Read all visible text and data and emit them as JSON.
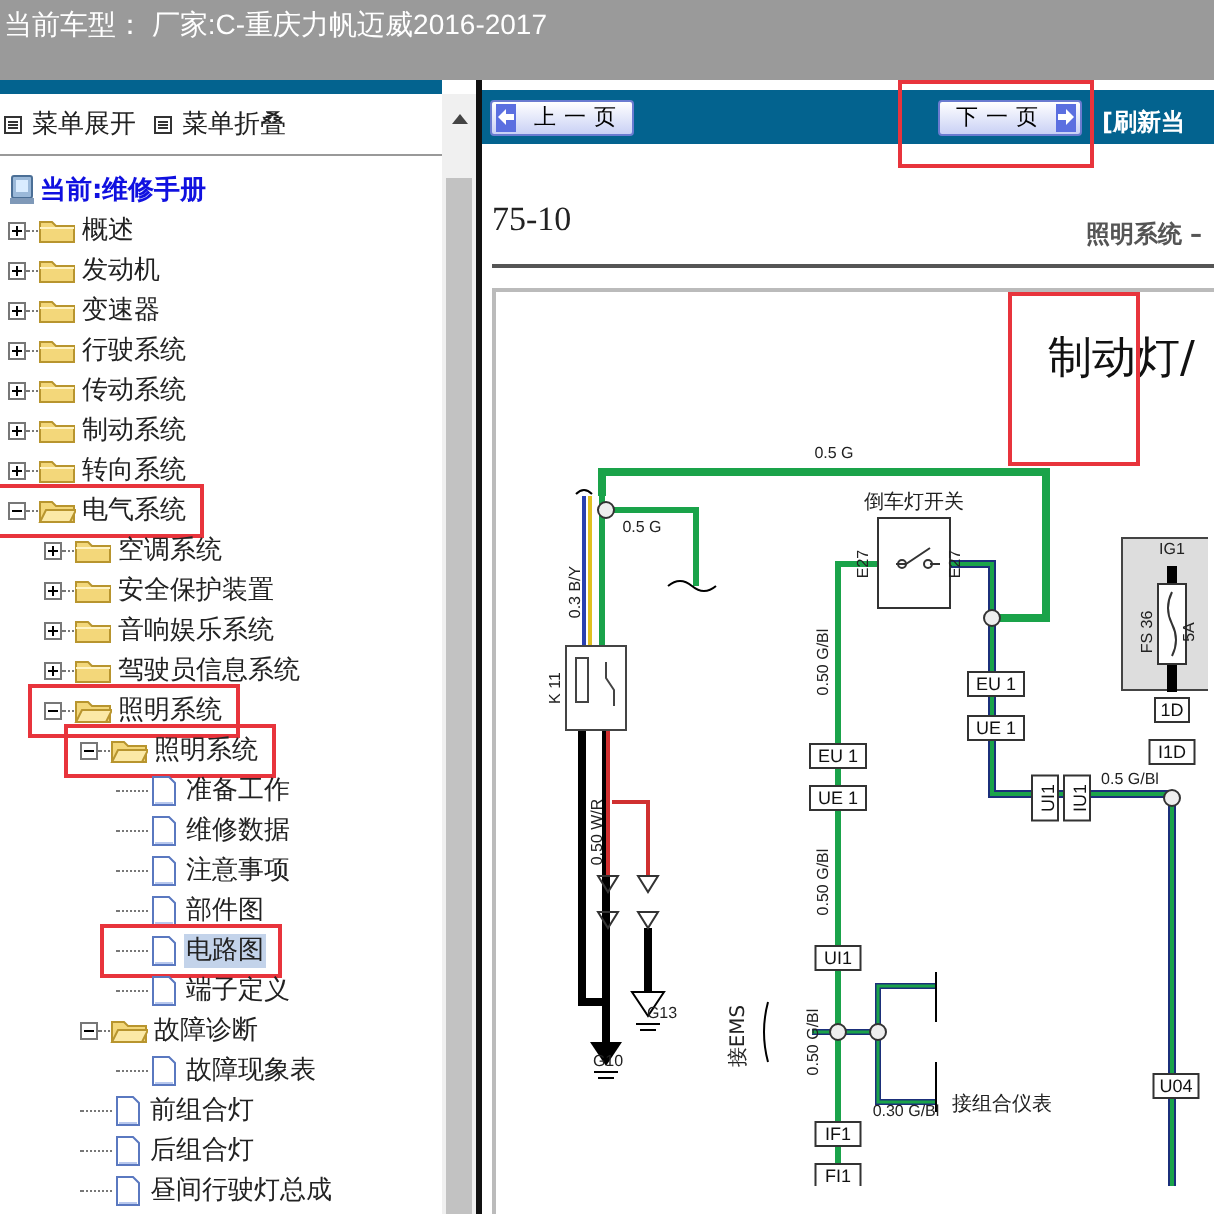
{
  "header": {
    "title": "当前车型： 厂家:C-重庆力帆迈威2016-2017"
  },
  "menu_controls": [
    {
      "label": "菜单展开"
    },
    {
      "label": "菜单折叠"
    }
  ],
  "tree": {
    "root": "当前:维修手册",
    "items": [
      {
        "label": "概述",
        "kind": "folder",
        "expanded": false,
        "selected": false,
        "highlighted": false
      },
      {
        "label": "发动机",
        "kind": "folder",
        "expanded": false,
        "selected": false,
        "highlighted": false
      },
      {
        "label": "变速器",
        "kind": "folder",
        "expanded": false,
        "selected": false,
        "highlighted": false
      },
      {
        "label": "行驶系统",
        "kind": "folder",
        "expanded": false,
        "selected": false,
        "highlighted": false
      },
      {
        "label": "传动系统",
        "kind": "folder",
        "expanded": false,
        "selected": false,
        "highlighted": false
      },
      {
        "label": "制动系统",
        "kind": "folder",
        "expanded": false,
        "selected": false,
        "highlighted": false
      },
      {
        "label": "转向系统",
        "kind": "folder",
        "expanded": false,
        "selected": false,
        "highlighted": false
      },
      {
        "label": "电气系统",
        "kind": "folder",
        "expanded": true,
        "selected": false,
        "highlighted": true,
        "children": [
          {
            "label": "空调系统",
            "kind": "folder",
            "expanded": false,
            "selected": false,
            "highlighted": false
          },
          {
            "label": "安全保护装置",
            "kind": "folder",
            "expanded": false,
            "selected": false,
            "highlighted": false
          },
          {
            "label": "音响娱乐系统",
            "kind": "folder",
            "expanded": false,
            "selected": false,
            "highlighted": false
          },
          {
            "label": "驾驶员信息系统",
            "kind": "folder",
            "expanded": false,
            "selected": false,
            "highlighted": false
          },
          {
            "label": "照明系统",
            "kind": "folder",
            "expanded": true,
            "selected": false,
            "highlighted": true,
            "children": [
              {
                "label": "照明系统",
                "kind": "folder",
                "expanded": true,
                "selected": false,
                "highlighted": true,
                "children": [
                  {
                    "label": "准备工作",
                    "kind": "doc",
                    "selected": false,
                    "highlighted": false
                  },
                  {
                    "label": "维修数据",
                    "kind": "doc",
                    "selected": false,
                    "highlighted": false
                  },
                  {
                    "label": "注意事项",
                    "kind": "doc",
                    "selected": false,
                    "highlighted": false
                  },
                  {
                    "label": "部件图",
                    "kind": "doc",
                    "selected": false,
                    "highlighted": false
                  },
                  {
                    "label": "电路图",
                    "kind": "doc",
                    "selected": true,
                    "highlighted": true
                  },
                  {
                    "label": "端子定义",
                    "kind": "doc",
                    "selected": false,
                    "highlighted": false
                  }
                ]
              },
              {
                "label": "故障诊断",
                "kind": "folder",
                "expanded": true,
                "selected": false,
                "highlighted": false,
                "children": [
                  {
                    "label": "故障现象表",
                    "kind": "doc",
                    "selected": false,
                    "highlighted": false
                  }
                ]
              },
              {
                "label": "前组合灯",
                "kind": "doc",
                "selected": false,
                "highlighted": false
              },
              {
                "label": "后组合灯",
                "kind": "doc",
                "selected": false,
                "highlighted": false
              },
              {
                "label": "昼间行驶灯总成",
                "kind": "doc",
                "selected": false,
                "highlighted": false
              }
            ]
          }
        ]
      }
    ]
  },
  "toolbar": {
    "buttons": [
      {
        "label": "上一页",
        "kind": "prev",
        "highlighted": false
      },
      {
        "label": "下一页",
        "kind": "next",
        "highlighted": true
      }
    ],
    "refresh_link": "[刷新当"
  },
  "document": {
    "page_number": "75-10",
    "running_head": "照明系统 –",
    "diagram_title": "制动灯/",
    "title_highlighted": true,
    "labels": [
      {
        "text": "0.5 G",
        "kind": "wire"
      },
      {
        "text": "0.5 G",
        "kind": "wire"
      },
      {
        "text": "0.3 B/Y",
        "kind": "wire"
      },
      {
        "text": "K 11",
        "kind": "wire"
      },
      {
        "text": "0.50 W/R",
        "kind": "wire"
      },
      {
        "text": "G13",
        "kind": "wire"
      },
      {
        "text": "G10",
        "kind": "wire"
      },
      {
        "text": "0.50 G/Bl",
        "kind": "wire"
      },
      {
        "text": "EU 1",
        "kind": "connector"
      },
      {
        "text": "UE 1",
        "kind": "connector"
      },
      {
        "text": "0.50 G/Bl",
        "kind": "wire"
      },
      {
        "text": "UI1",
        "kind": "connector"
      },
      {
        "text": "0.50 G/Bl",
        "kind": "wire"
      },
      {
        "text": "IF1",
        "kind": "connector"
      },
      {
        "text": "FI1",
        "kind": "connector"
      },
      {
        "text": "0.30 G/Bl",
        "kind": "wire"
      },
      {
        "text": "EU 1",
        "kind": "connector"
      },
      {
        "text": "UE 1",
        "kind": "connector"
      },
      {
        "text": "0.5 G/Bl",
        "kind": "wire"
      },
      {
        "text": "IG1",
        "kind": "wire"
      },
      {
        "text": "FS 36",
        "kind": "wire"
      },
      {
        "text": "5A",
        "kind": "wire"
      },
      {
        "text": "1D",
        "kind": "connector"
      },
      {
        "text": "I1D",
        "kind": "connector"
      },
      {
        "text": "U04",
        "kind": "connector"
      },
      {
        "text": "E27",
        "kind": "wire"
      },
      {
        "text": "E27",
        "kind": "wire"
      },
      {
        "text": "接EMS",
        "kind": "note"
      },
      {
        "text": "接组合仪表",
        "kind": "note"
      },
      {
        "text": "倒车灯开关",
        "kind": "note"
      },
      {
        "text": "UI1",
        "kind": "connector"
      },
      {
        "text": "IU1",
        "kind": "connector"
      }
    ]
  }
}
